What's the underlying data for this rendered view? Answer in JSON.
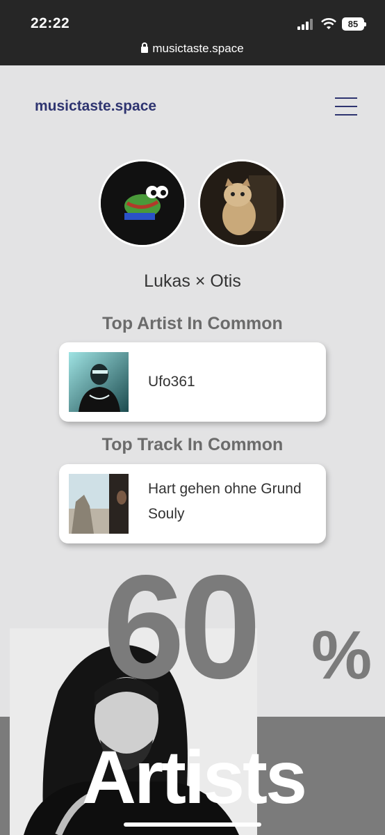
{
  "status_bar": {
    "time": "22:22",
    "battery": "85",
    "url": "musictaste.space"
  },
  "header": {
    "logo": "musictaste.space"
  },
  "comparison": {
    "names": "Lukas × Otis"
  },
  "top_artist": {
    "title": "Top Artist In Common",
    "artist": "Ufo361"
  },
  "top_track": {
    "title": "Top Track In Common",
    "track": "Hart gehen ohne Grund",
    "artist": "Souly"
  },
  "stats": {
    "value": "60",
    "unit": "%",
    "label": "Artists"
  }
}
